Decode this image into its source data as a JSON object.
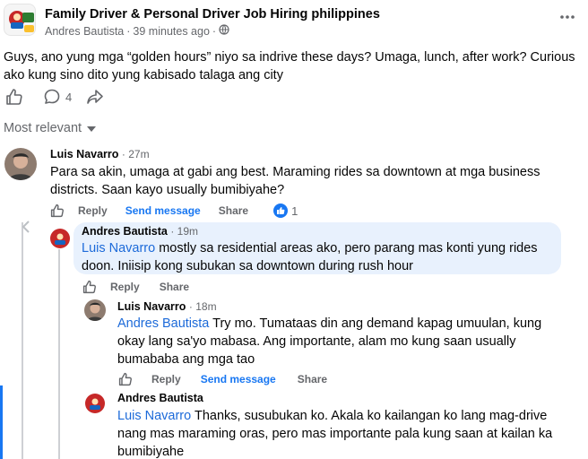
{
  "post": {
    "group_name": "Family Driver & Personal Driver Job Hiring philippines",
    "author": "Andres Bautista",
    "separator": "·",
    "time": "39 minutes ago",
    "separator2": "·",
    "text": "Guys, ano yung mga “golden hours” niyo sa indrive these days? Umaga, lunch, after work? Curious ako kung sino dito yung kabisado talaga ang city",
    "comment_count": "4",
    "sort_label": "Most relevant"
  },
  "comments": [
    {
      "name": "Luis Navarro",
      "time": "· 27m",
      "mention": "",
      "text": "Para sa akin, umaga at gabi ang best. Maraming rides sa downtown at mga business districts. Saan kayo usually bumibiyahe?",
      "reply": "Reply",
      "send": "Send message",
      "share": "Share",
      "reactions": "1"
    },
    {
      "name": "Andres Bautista",
      "time": "· 19m",
      "mention": "Luis Navarro",
      "text": " mostly sa residential areas ako, pero parang mas konti yung rides doon. Iniisip kong subukan sa downtown during rush hour",
      "reply": "Reply",
      "share": "Share"
    },
    {
      "name": "Luis Navarro",
      "time": "· 18m",
      "mention": "Andres Bautista",
      "text": " Try mo. Tumataas din ang demand kapag umuulan, kung okay lang sa'yo mabasa. Ang importante, alam mo kung saan usually bumababa ang mga tao",
      "reply": "Reply",
      "send": "Send message",
      "share": "Share"
    },
    {
      "name": "Andres Bautista",
      "time": "",
      "mention": "Luis Navarro",
      "text": " Thanks, susubukan ko. Akala ko kailangan ko lang mag-drive nang mas maraming oras, pero mas importante pala kung saan at kailan ka bumibiyahe"
    }
  ],
  "colors": {
    "accent": "#1877f2",
    "mention": "#1c6ad9",
    "highlight": "#e8f1fd",
    "muted": "#65676b"
  },
  "icons": {
    "more": "more-dots-icon",
    "globe": "globe-icon",
    "like": "thumbs-up-icon",
    "comment": "comment-bubble-icon",
    "share": "share-arrow-icon",
    "sort": "caret-down-icon"
  }
}
